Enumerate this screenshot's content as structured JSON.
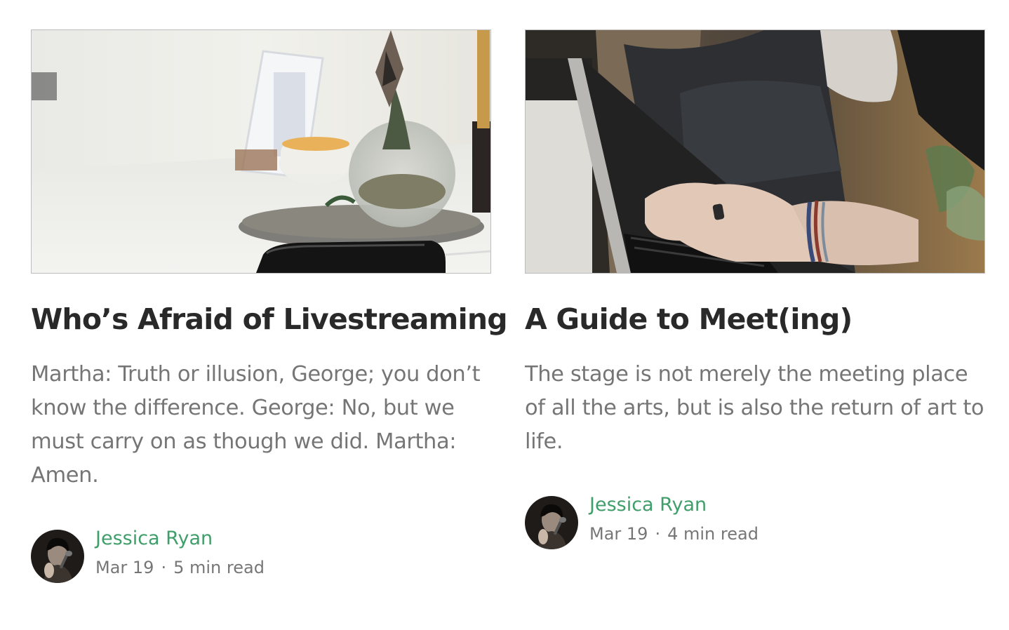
{
  "colors": {
    "accent": "#3f9e6a",
    "title": "#242424",
    "excerpt": "#757575"
  },
  "cards": [
    {
      "image": "desk-with-vase-photo",
      "title": "Who’s Afraid of Livestreaming",
      "excerpt": "Martha: Truth or illusion, George; you don’t know the difference. George: No, but we must carry on as though we did. Martha: Amen.",
      "author": "Jessica Ryan",
      "date": "Mar 19",
      "separator": "·",
      "read_time": "5 min read"
    },
    {
      "image": "typing-on-laptop-photo",
      "title": "A Guide to Meet(ing)",
      "excerpt": "The stage is not merely the meeting place of all the arts, but is also the return of art to life.",
      "author": "Jessica Ryan",
      "date": "Mar 19",
      "separator": "·",
      "read_time": "4 min read"
    }
  ]
}
